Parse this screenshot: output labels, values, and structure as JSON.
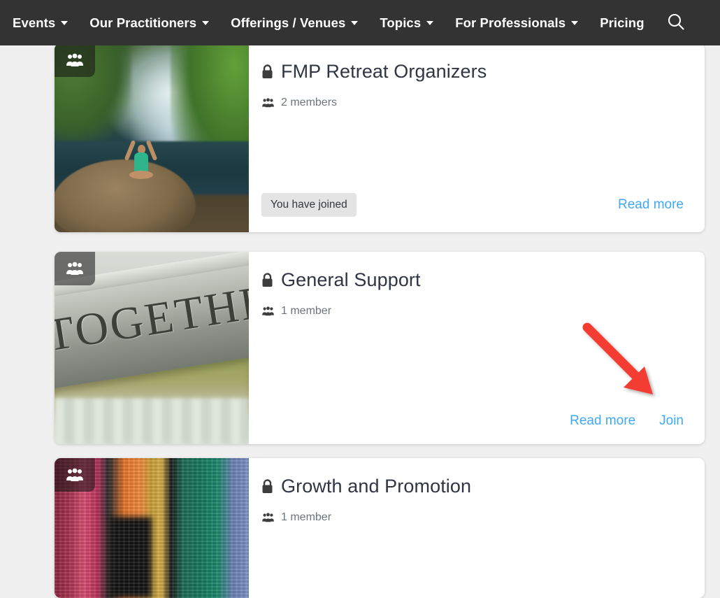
{
  "navbar": {
    "background_color": "#333333",
    "text_color": "#ffffff",
    "items": [
      {
        "label": "Events",
        "has_dropdown": true
      },
      {
        "label": "Our Practitioners",
        "has_dropdown": true
      },
      {
        "label": "Offerings / Venues",
        "has_dropdown": true
      },
      {
        "label": "Topics",
        "has_dropdown": true
      },
      {
        "label": "For Professionals",
        "has_dropdown": true
      },
      {
        "label": "Pricing",
        "has_dropdown": false
      }
    ],
    "search_icon": "search-icon"
  },
  "page": {
    "background_color": "#f0f0f0",
    "link_color": "#3fa9f5",
    "annotation_color": "#f43e33"
  },
  "groups": [
    {
      "title": "FMP Retreat Organizers",
      "privacy_icon": "lock-icon",
      "members_text": "2 members",
      "members_icon": "users-icon",
      "thumbnail_badge_icon": "users-icon",
      "thumbnail_alt": "Woman doing yoga on a rock in front of a tropical waterfall",
      "status_badge": "You have joined",
      "links": [
        "Read more"
      ]
    },
    {
      "title": "General Support",
      "privacy_icon": "lock-icon",
      "members_text": "1 member",
      "members_icon": "users-icon",
      "thumbnail_badge_icon": "users-icon",
      "thumbnail_alt": "Wooden bench engraved with the word TOGETHER",
      "thumbnail_word": "TOGETHER",
      "status_badge": null,
      "links": [
        "Read more",
        "Join"
      ]
    },
    {
      "title": "Growth and Promotion",
      "privacy_icon": "lock-icon",
      "members_text": "1 member",
      "members_icon": "users-icon",
      "thumbnail_badge_icon": "users-icon",
      "thumbnail_alt": "Close-up of colorful knitted sweaters",
      "status_badge": null,
      "links": []
    }
  ],
  "annotation": {
    "type": "arrow",
    "color": "#f43e33",
    "points_to": "Join"
  }
}
